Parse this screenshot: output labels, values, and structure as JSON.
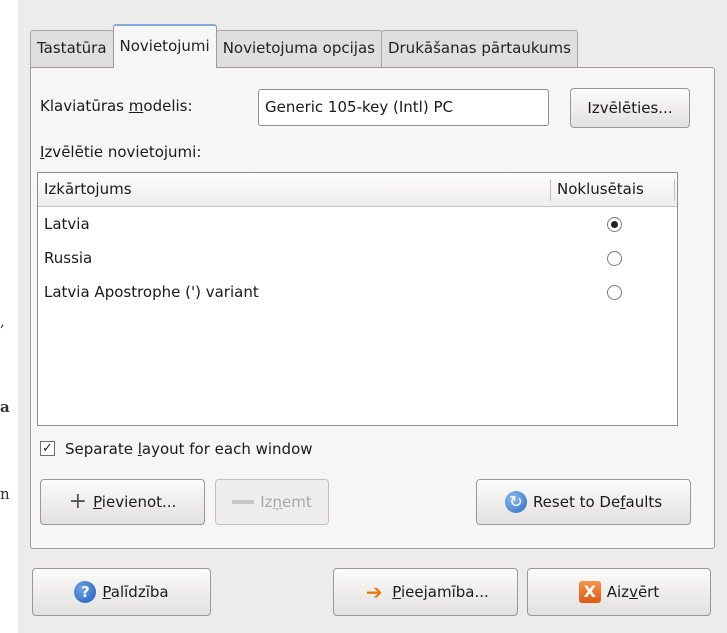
{
  "stray_glyphs": [
    ",",
    "a",
    "n"
  ],
  "tabs": [
    {
      "label": "Tastatūra",
      "active": false
    },
    {
      "label": "Novietojumi",
      "active": true
    },
    {
      "label": "Novietojuma opcijas",
      "active": false
    },
    {
      "label": "Drukāšanas pārtaukums",
      "active": false
    }
  ],
  "model": {
    "label_pre": "Klaviatūras ",
    "label_u": "m",
    "label_post": "odelis:",
    "value": "Generic 105-key (Intl) PC",
    "choose_label": "Izvēlēties..."
  },
  "selected_layouts": {
    "label_u": "I",
    "label_post": "zvēlētie novietojumi:"
  },
  "table": {
    "col_layout": "Izkārtojums",
    "col_default": "Noklusētais",
    "rows": [
      {
        "name": "Latvia",
        "default": true
      },
      {
        "name": "Russia",
        "default": false
      },
      {
        "name": "Latvia Apostrophe (') variant",
        "default": false
      }
    ]
  },
  "separate": {
    "checked": true,
    "check_glyph": "✓",
    "label_pre": "Separate ",
    "label_u": "l",
    "label_post": "ayout for each window"
  },
  "buttons": {
    "add_u": "P",
    "add_post": "ievienot...",
    "remove_pre": "Iz",
    "remove_u": "ņ",
    "remove_post": "emt",
    "reset_pre": "Reset to De",
    "reset_u": "f",
    "reset_post": "aults",
    "help_u": "P",
    "help_post": "alīdzība",
    "access_u": "P",
    "access_post": "ieejamība...",
    "close_pre": "Aiz",
    "close_u": "v",
    "close_post": "ērt"
  },
  "icons": {
    "help": "?",
    "close": "X",
    "reset": "↻",
    "access": "➔",
    "add": "+"
  }
}
